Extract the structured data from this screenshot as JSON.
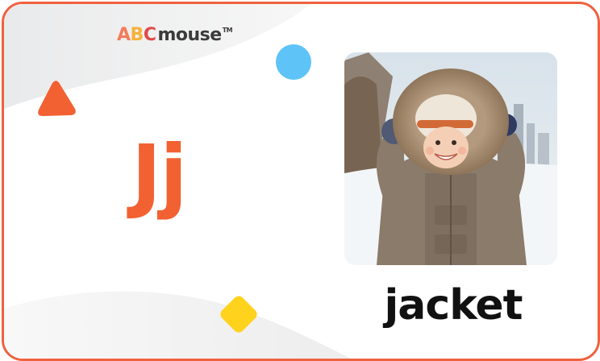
{
  "brand": {
    "letters": [
      {
        "char": "A",
        "color": "#f47b5a"
      },
      {
        "char": "B",
        "color": "#f6b13c"
      },
      {
        "char": "C",
        "color": "#e04a4a"
      }
    ],
    "word": "mouse",
    "trademark": "TM"
  },
  "flashcard": {
    "letter_pair": "Jj",
    "word": "jacket",
    "image_subject": "child-in-fur-hood-jacket"
  },
  "decorations": {
    "triangle_color": "#f26132",
    "circle_color": "#5ec3f7",
    "diamond_color": "#ffd21e",
    "border_color": "#f0613f"
  }
}
